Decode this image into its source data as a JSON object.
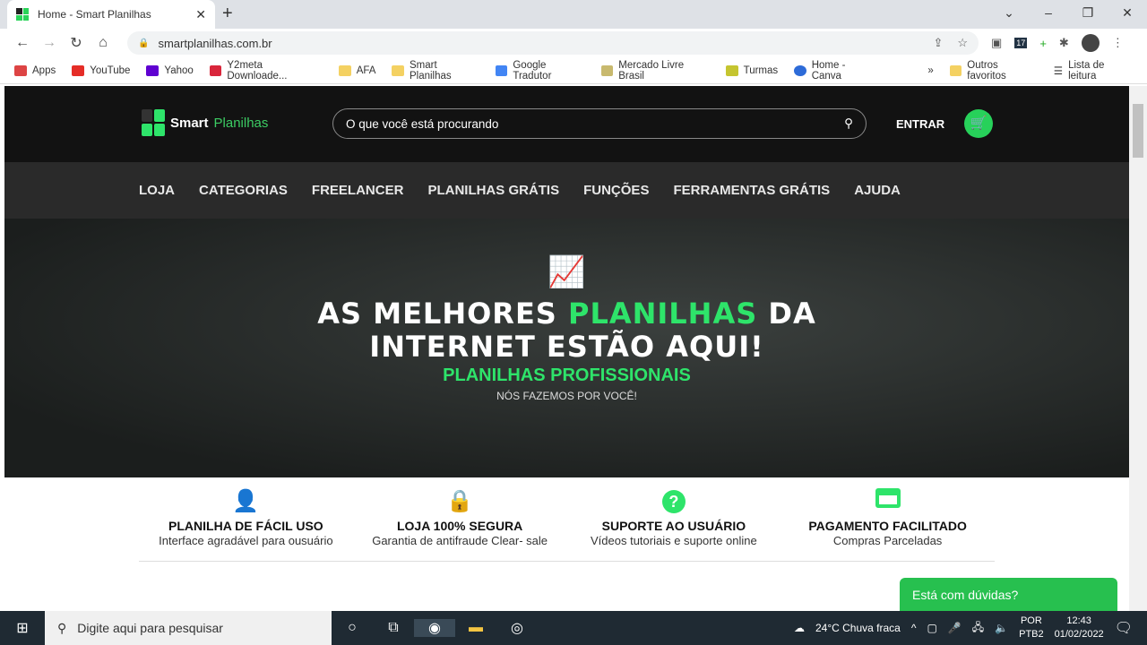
{
  "browser": {
    "tab_title": "Home - Smart Planilhas",
    "url": "smartplanilhas.com.br",
    "bookmarks": [
      {
        "label": "Apps",
        "color": "#d44"
      },
      {
        "label": "YouTube",
        "color": "#e52d27"
      },
      {
        "label": "Yahoo",
        "color": "#5f01d1"
      },
      {
        "label": "Y2meta Downloade...",
        "color": "#d9263b"
      },
      {
        "label": "AFA",
        "color": "#f4d162"
      },
      {
        "label": "Smart Planilhas",
        "color": "#f4d162"
      },
      {
        "label": "Google Tradutor",
        "color": "#4285f4"
      },
      {
        "label": "Mercado Livre Brasil",
        "color": "#c8b96e"
      },
      {
        "label": "Turmas",
        "color": "#c5c530"
      },
      {
        "label": "Home - Canva",
        "color": "#2d6bd8"
      }
    ],
    "other_bookmarks": "Outros favoritos",
    "reading_list": "Lista de leitura",
    "ext_badge": "17"
  },
  "site": {
    "logo_a": "Smart",
    "logo_b": "Planilhas",
    "search_placeholder": "O que você está procurando",
    "login": "ENTRAR",
    "menu": [
      "LOJA",
      "CATEGORIAS",
      "FREELANCER",
      "PLANILHAS GRÁTIS",
      "FUNÇÕES",
      "FERRAMENTAS GRÁTIS",
      "AJUDA"
    ],
    "hero": {
      "line1a": "AS MELHORES ",
      "line1b": "PLANILHAS",
      "line1c": " DA",
      "line2": "INTERNET ESTÃO AQUI!",
      "sub": "PLANILHAS PROFISSIONAIS",
      "tag": "NÓS FAZEMOS POR VOCÊ!"
    },
    "features": [
      {
        "icon": "user-check-icon",
        "glyph": "👤",
        "title": "PLANILHA DE FÁCIL USO",
        "desc": "Interface agradável para ousuário"
      },
      {
        "icon": "lock-icon",
        "glyph": "🔒",
        "title": "LOJA 100% SEGURA",
        "desc": "Garantia de antifraude Clear- sale"
      },
      {
        "icon": "help-icon",
        "glyph": "?",
        "title": "SUPORTE AO USUÁRIO",
        "desc": "Vídeos tutoriais e suporte online"
      },
      {
        "icon": "credit-card-icon",
        "glyph": "▬",
        "title": "PAGAMENTO FACILITADO",
        "desc": "Compras Parceladas"
      }
    ],
    "chat": "Está com dúvidas?"
  },
  "taskbar": {
    "search": "Digite aqui para pesquisar",
    "weather": "24°C  Chuva fraca",
    "lang1": "POR",
    "lang2": "PTB2",
    "time": "12:43",
    "date": "01/02/2022"
  }
}
